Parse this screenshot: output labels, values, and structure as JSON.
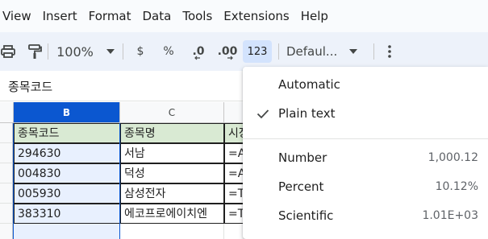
{
  "menubar": {
    "items": [
      "View",
      "Insert",
      "Format",
      "Data",
      "Tools",
      "Extensions",
      "Help"
    ]
  },
  "toolbar": {
    "icons": [
      "print-icon",
      "paint-format-icon"
    ],
    "zoom": "100%",
    "currency": "$",
    "percent": "%",
    "decrease_decimal": ".0",
    "increase_decimal": ".00",
    "more_formats": "123",
    "font": "Defaul...",
    "active_color": "#d3e3fd"
  },
  "namebox": {
    "value": "종목코드"
  },
  "grid": {
    "columns": [
      "B",
      "C"
    ],
    "selected_column": "B",
    "header_row": [
      "종목코드",
      "종목명",
      "시장"
    ],
    "rows": [
      [
        "294630",
        "서남",
        "=A"
      ],
      [
        "004830",
        "덕성",
        "=A"
      ],
      [
        "005930",
        "삼성전자",
        "=T"
      ],
      [
        "383310",
        "에코프로에이치엔",
        "=T"
      ]
    ],
    "header_fill": "#d9ead3",
    "selection_color": "#0b57d0"
  },
  "format_menu": {
    "items": [
      {
        "label": "Automatic",
        "value": "",
        "checked": false
      },
      {
        "label": "Plain text",
        "value": "",
        "checked": true
      },
      {
        "label": "Number",
        "value": "1,000.12",
        "checked": false
      },
      {
        "label": "Percent",
        "value": "10.12%",
        "checked": false
      },
      {
        "label": "Scientific",
        "value": "1.01E+03",
        "checked": false
      }
    ]
  }
}
